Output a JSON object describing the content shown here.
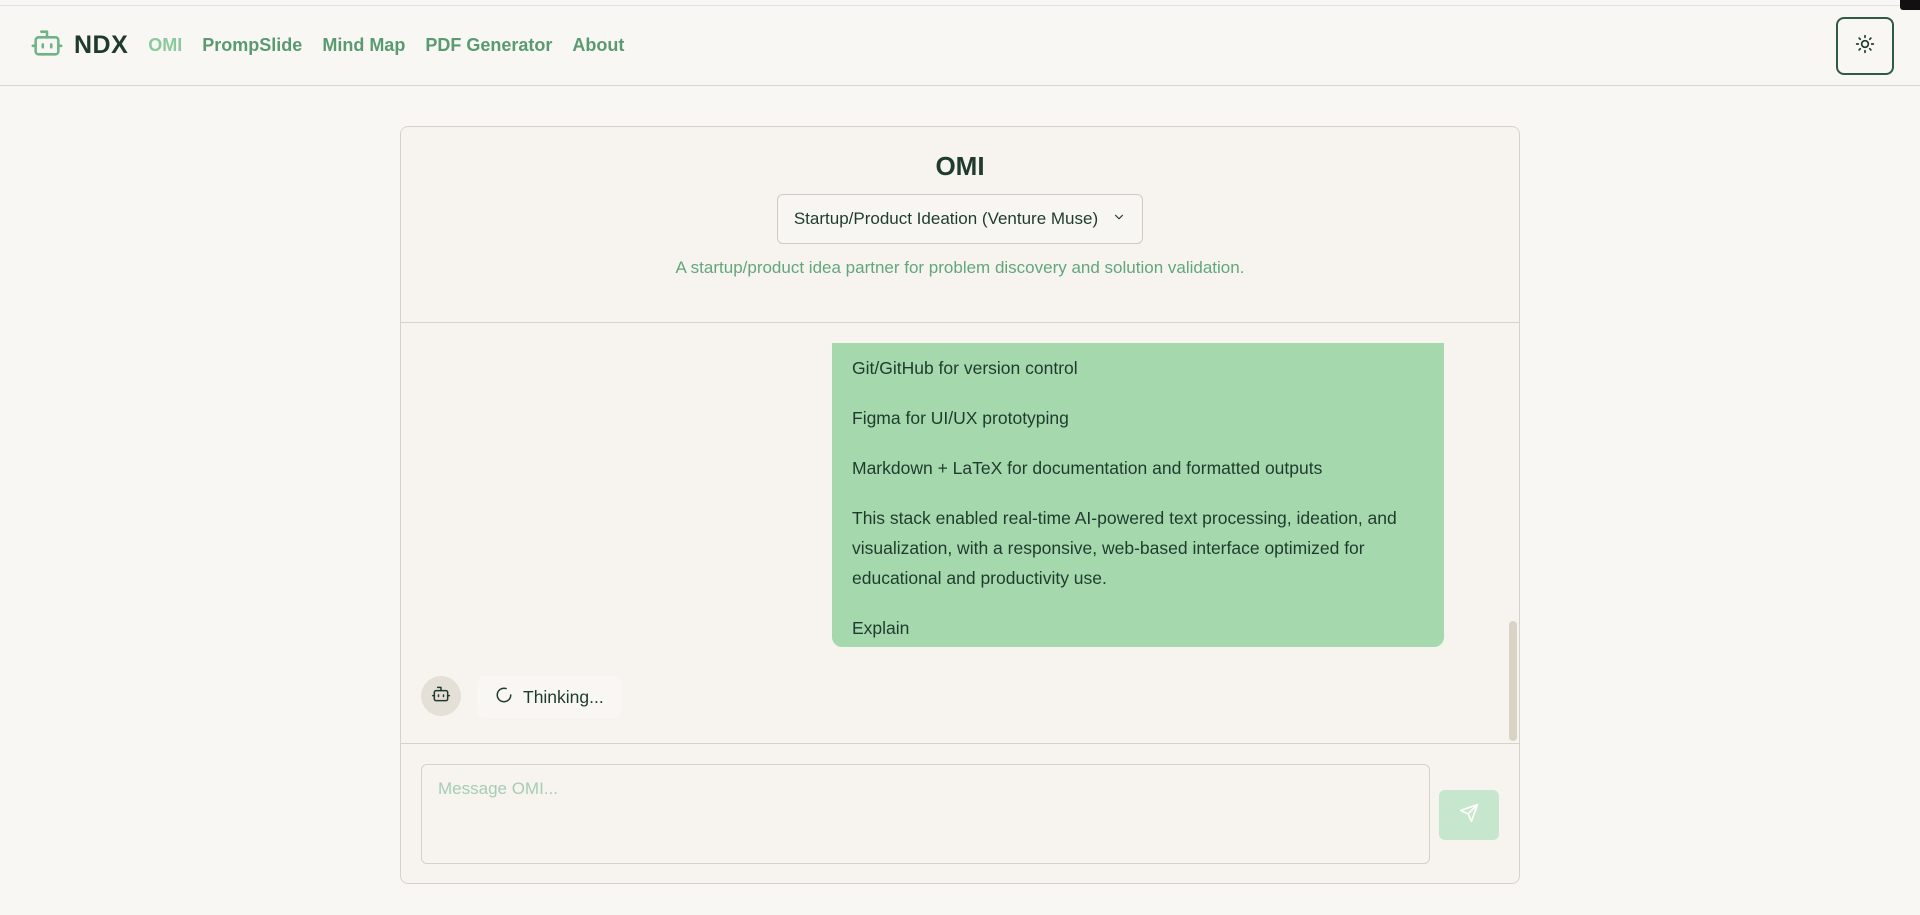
{
  "brand": {
    "name": "NDX",
    "logo_icon": "robot-icon",
    "accent": "#5a9a72"
  },
  "nav": {
    "items": [
      {
        "label": "OMI",
        "active": true
      },
      {
        "label": "PrompSlide"
      },
      {
        "label": "Mind Map"
      },
      {
        "label": "PDF Generator"
      },
      {
        "label": "About"
      }
    ]
  },
  "header": {
    "theme_toggle_icon": "sun-icon"
  },
  "card": {
    "title": "OMI",
    "mode_select": {
      "value": "Startup/Product Ideation (Venture Muse)",
      "icon": "chevron-down-icon"
    },
    "description": "A startup/product idea partner for problem discovery and solution validation."
  },
  "messages": {
    "user_bubble": {
      "color": "#a5d8ad",
      "paragraphs": [
        "Git/GitHub for version control",
        "Figma for UI/UX prototyping",
        "Markdown + LaTeX for documentation and formatted outputs",
        "This stack enabled real-time AI-powered text processing, ideation, and visualization, with a responsive, web-based interface optimized for educational and productivity use.",
        "Explain"
      ]
    },
    "assistant_status": {
      "text": "Thinking...",
      "icon": "spinner-icon",
      "avatar_icon": "robot-icon"
    }
  },
  "composer": {
    "placeholder": "Message OMI...",
    "value": "",
    "send_icon": "send-icon"
  }
}
